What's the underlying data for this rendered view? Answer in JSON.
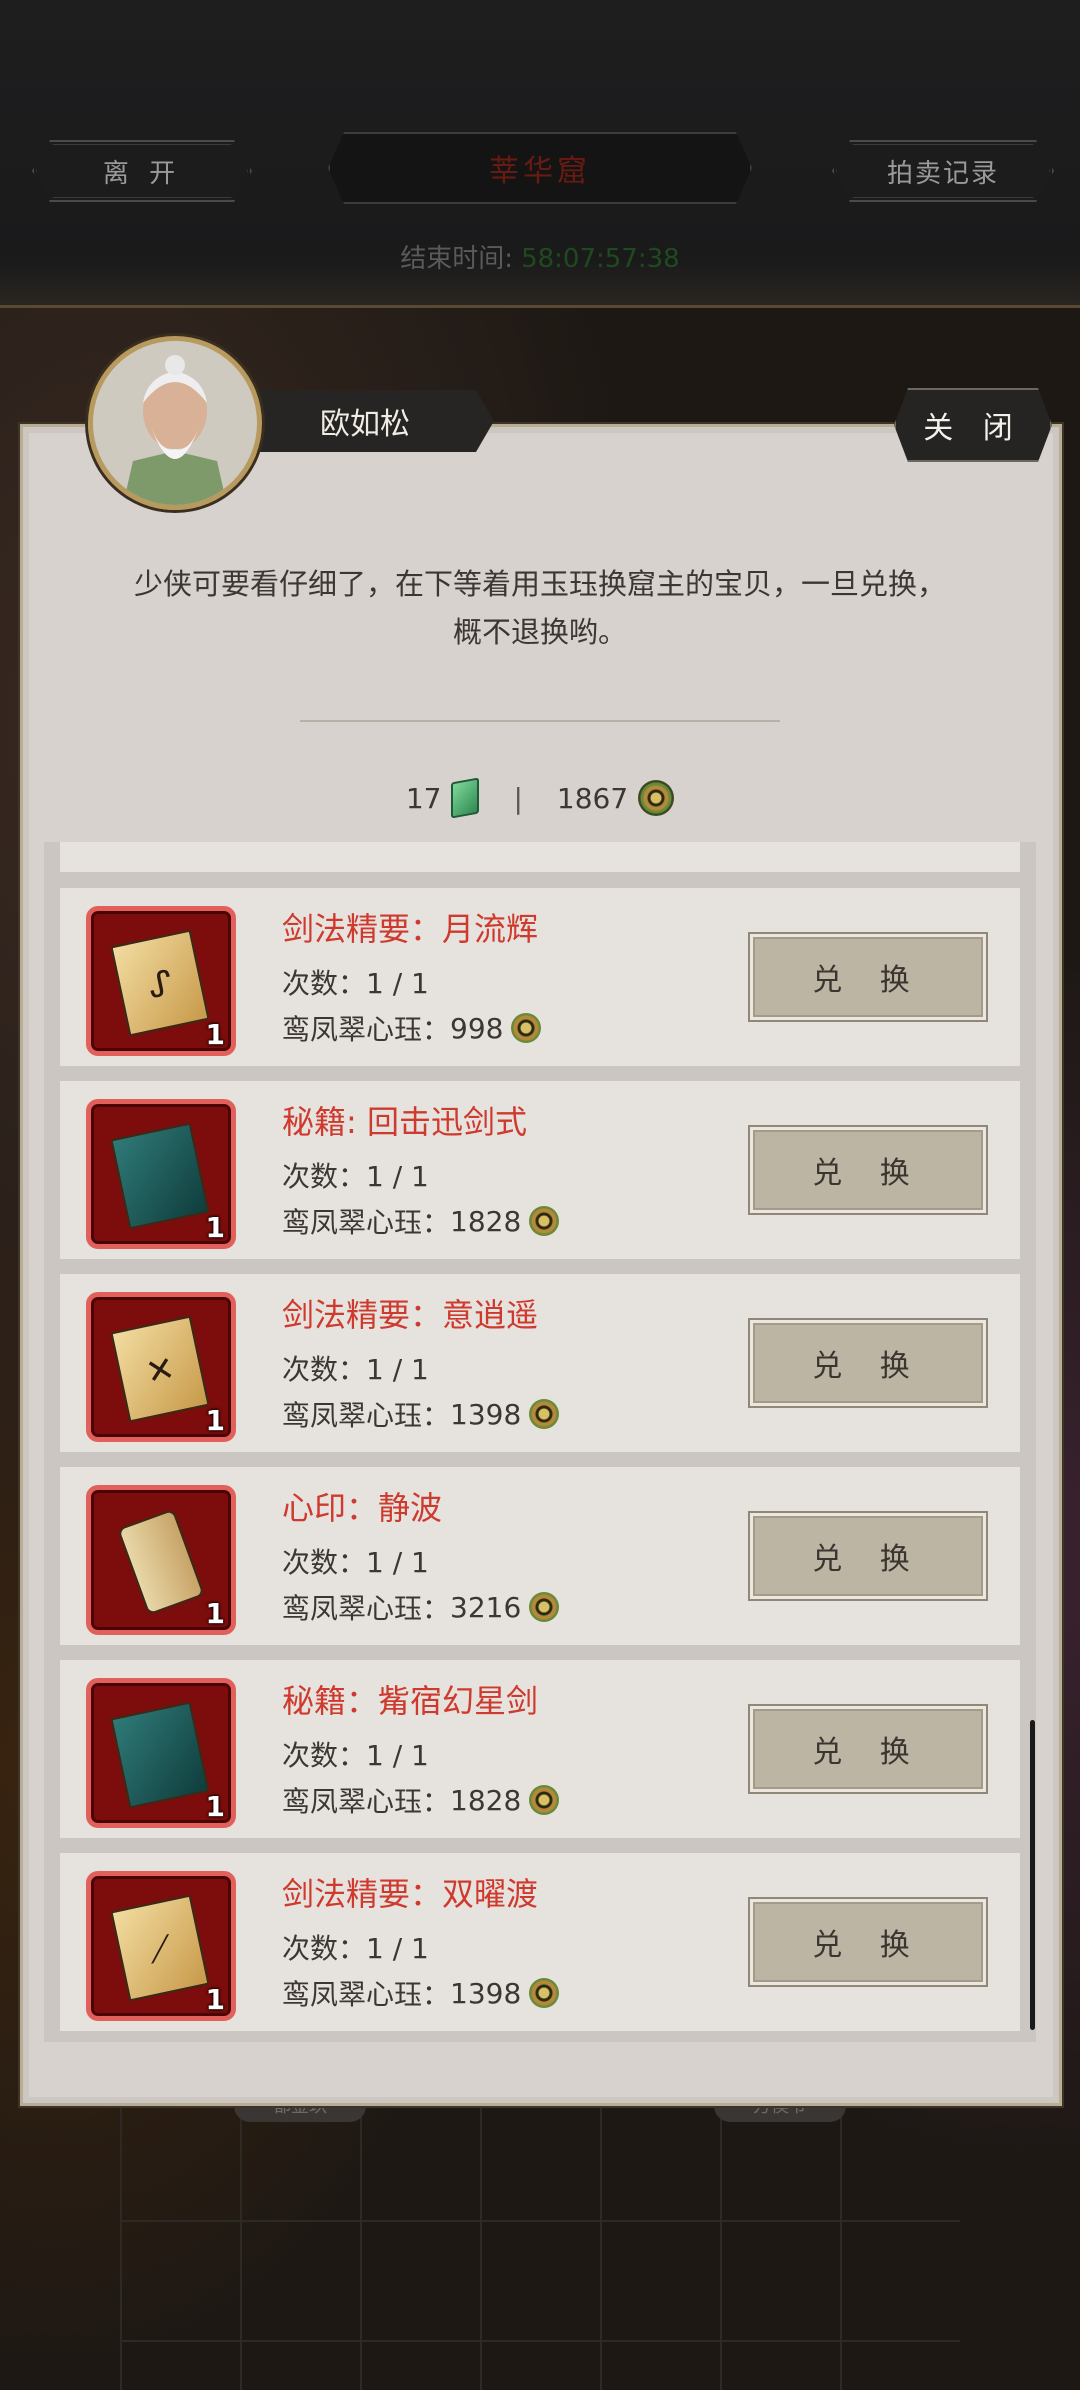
{
  "top_bar": {
    "leave_label": "离 开",
    "title": "莘华窟",
    "auction_label": "拍卖记录",
    "end_time_label": "结束时间:",
    "end_time_value": "58:07:57:38"
  },
  "dialog": {
    "npc_name": "欧如松",
    "close_label": "关 闭",
    "speech_line1": "少侠可要看仔细了，在下等着用玉珏换窟主的宝贝，一旦兑换，",
    "speech_line2": "概不退换哟。",
    "currency": {
      "jade_count": "17",
      "jade_icon": "jade-icon",
      "separator": "|",
      "coin_count": "1867",
      "coin_icon": "coin-icon"
    }
  },
  "items": [
    {
      "name": "剑法精要：月流辉",
      "count": "次数：1 / 1",
      "cost_label": "鸾凤翠心珏：",
      "cost": "998",
      "qty": "1",
      "icon": "yellow-book",
      "glyph": "ᔑ",
      "button": "兑 换"
    },
    {
      "name": "秘籍: 回击迅剑式",
      "count": "次数：1 / 1",
      "cost_label": "鸾凤翠心珏：",
      "cost": "1828",
      "qty": "1",
      "icon": "teal-book",
      "glyph": "",
      "button": "兑 换"
    },
    {
      "name": "剑法精要：意逍遥",
      "count": "次数：1 / 1",
      "cost_label": "鸾凤翠心珏：",
      "cost": "1398",
      "qty": "1",
      "icon": "yellow-book",
      "glyph": "✕",
      "button": "兑 换"
    },
    {
      "name": "心印：静波",
      "count": "次数：1 / 1",
      "cost_label": "鸾凤翠心珏：",
      "cost": "3216",
      "qty": "1",
      "icon": "scroll",
      "glyph": "",
      "button": "兑 换"
    },
    {
      "name": "秘籍：觜宿幻星剑",
      "count": "次数：1 / 1",
      "cost_label": "鸾凤翠心珏：",
      "cost": "1828",
      "qty": "1",
      "icon": "teal-book",
      "glyph": "",
      "button": "兑 换"
    },
    {
      "name": "剑法精要：双曜渡",
      "count": "次数：1 / 1",
      "cost_label": "鸾凤翠心珏：",
      "cost": "1398",
      "qty": "1",
      "icon": "yellow-book",
      "glyph": "⟋",
      "button": "兑 换"
    }
  ],
  "scene": {
    "tag_left": "都金玖",
    "tag_right": "方侯爷"
  }
}
